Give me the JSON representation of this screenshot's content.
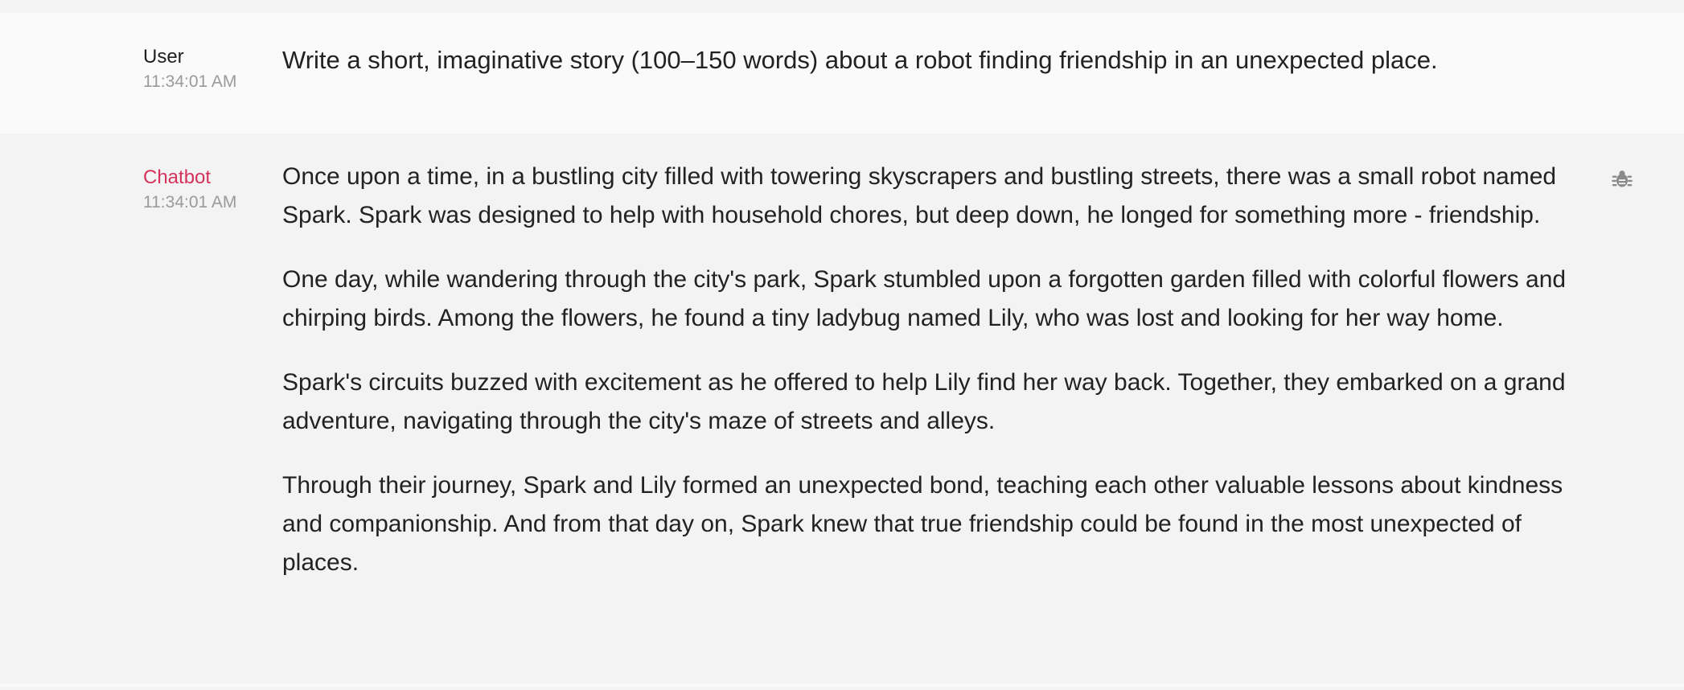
{
  "conversation": {
    "user_message": {
      "author": "User",
      "timestamp": "11:34:01 AM",
      "text": "Write a short, imaginative story (100–150 words) about a robot finding friendship in an unexpected place."
    },
    "bot_message": {
      "author": "Chatbot",
      "timestamp": "11:34:01 AM",
      "paragraphs": [
        "Once upon a time, in a bustling city filled with towering skyscrapers and bustling streets, there was a small robot named Spark. Spark was designed to help with household chores, but deep down, he longed for something more - friendship.",
        "One day, while wandering through the city's park, Spark stumbled upon a forgotten garden filled with colorful flowers and chirping birds. Among the flowers, he found a tiny ladybug named Lily, who was lost and looking for her way home.",
        "Spark's circuits buzzed with excitement as he offered to help Lily find her way back. Together, they embarked on a grand adventure, navigating through the city's maze of streets and alleys.",
        "Through their journey, Spark and Lily formed an unexpected bond, teaching each other valuable lessons about kindness and companionship. And from that day on, Spark knew that true friendship could be found in the most unexpected of places."
      ],
      "debug_icon": "bug-icon"
    }
  },
  "colors": {
    "bot_author": "#d6335c",
    "user_bg": "#fafafa",
    "bot_bg": "#f3f3f3",
    "timestamp": "#9a9a9a"
  }
}
